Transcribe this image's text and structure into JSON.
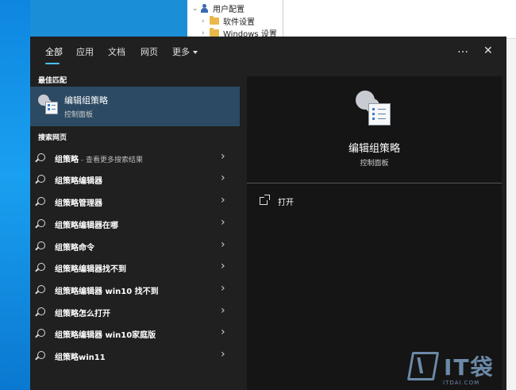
{
  "explorer": {
    "tree": [
      {
        "label": "用户配置",
        "icon": "user-icon"
      },
      {
        "label": "软件设置",
        "icon": "folder-icon"
      },
      {
        "label": "Windows 设置",
        "icon": "folder-icon"
      }
    ]
  },
  "search": {
    "tabs": [
      {
        "label": "全部",
        "active": true
      },
      {
        "label": "应用"
      },
      {
        "label": "文档"
      },
      {
        "label": "网页"
      },
      {
        "label": "更多"
      }
    ],
    "more_icon": "…",
    "close_icon": "✕",
    "best_match_heading": "最佳匹配",
    "best_match": {
      "title": "编辑组策略",
      "subtitle": "控制面板",
      "icon": "group-policy-icon"
    },
    "web_heading": "搜索网页",
    "web_results": [
      {
        "label": "组策略",
        "suffix": " - 查看更多搜索结果"
      },
      {
        "label": "组策略编辑器",
        "suffix": ""
      },
      {
        "label": "组策略管理器",
        "suffix": ""
      },
      {
        "label": "组策略编辑器在哪",
        "suffix": ""
      },
      {
        "label": "组策略命令",
        "suffix": ""
      },
      {
        "label": "组策略编辑器找不到",
        "suffix": ""
      },
      {
        "label": "组策略编辑器 win10 找不到",
        "suffix": ""
      },
      {
        "label": "组策略怎么打开",
        "suffix": ""
      },
      {
        "label": "组策略编辑器 win10家庭版",
        "suffix": ""
      },
      {
        "label": "组策略win11",
        "suffix": ""
      }
    ],
    "chevron": "›",
    "preview": {
      "title": "编辑组策略",
      "subtitle": "控制面板",
      "open_label": "打开"
    }
  },
  "watermark": {
    "text": "IT袋",
    "url": "ITDAI.COM"
  },
  "colors": {
    "panel": "#202020",
    "highlight": "#2c4a63",
    "accent": "#4cc2ff",
    "desktop": "#1a8fd8"
  }
}
